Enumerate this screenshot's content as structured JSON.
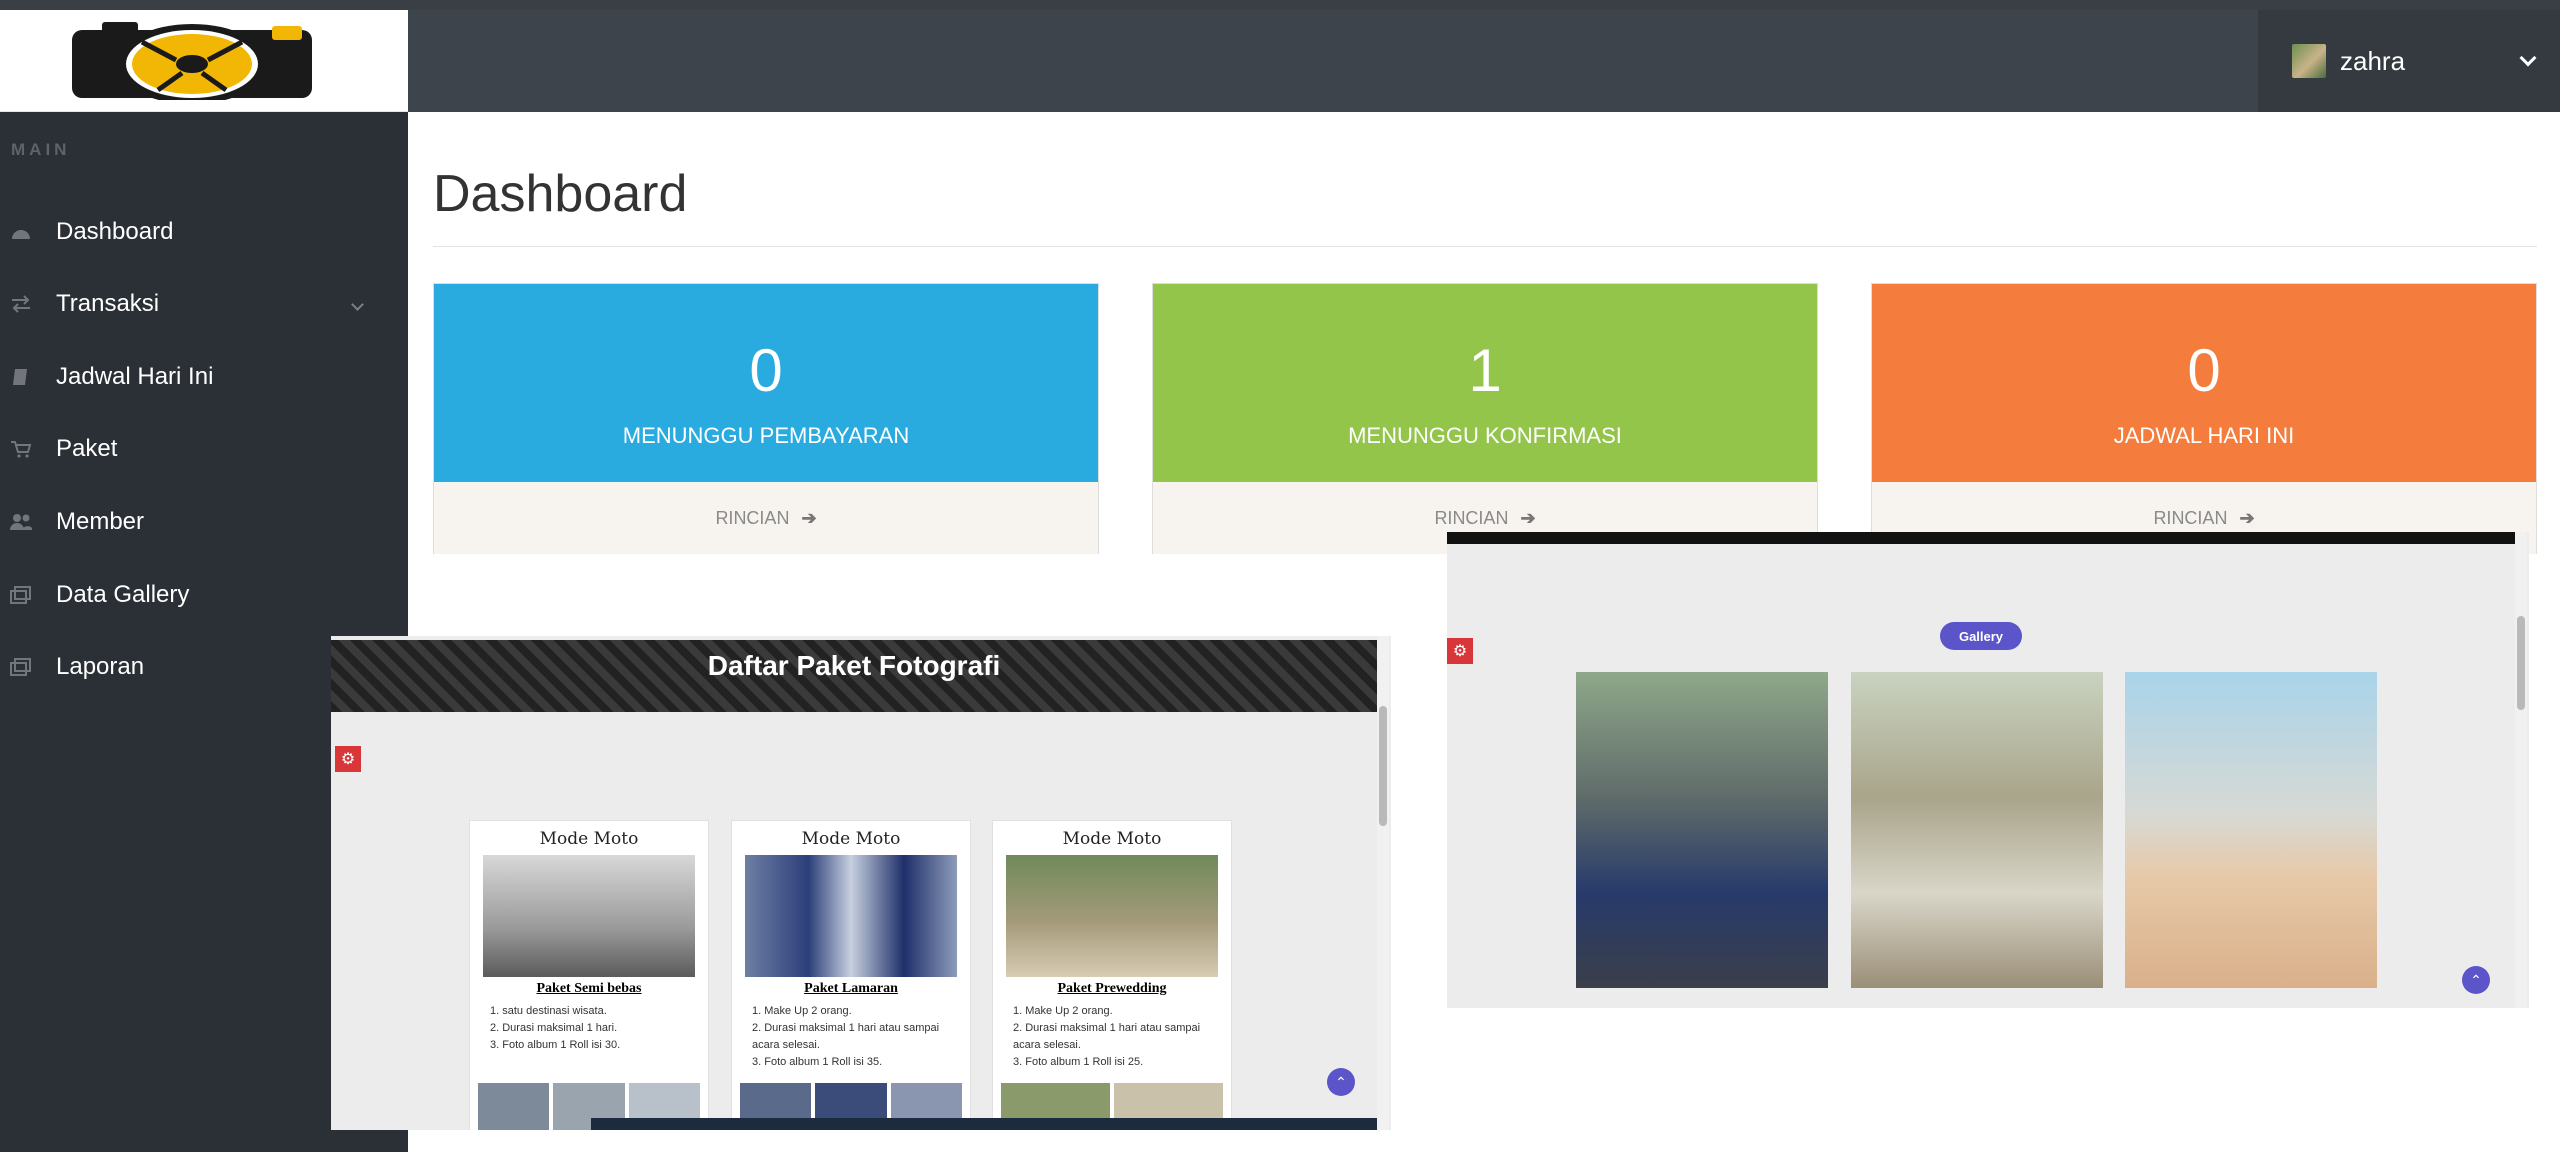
{
  "header": {
    "user": {
      "name": "zahra"
    }
  },
  "sidebar": {
    "heading": "MAIN",
    "items": [
      {
        "label": "Dashboard",
        "icon": "dashboard-icon"
      },
      {
        "label": "Transaksi",
        "icon": "exchange-icon",
        "has_submenu": true
      },
      {
        "label": "Jadwal Hari Ini",
        "icon": "book-icon"
      },
      {
        "label": "Paket",
        "icon": "cart-icon"
      },
      {
        "label": "Member",
        "icon": "users-icon"
      },
      {
        "label": "Data Gallery",
        "icon": "gallery-icon"
      },
      {
        "label": "Laporan",
        "icon": "report-icon"
      }
    ]
  },
  "main": {
    "title": "Dashboard",
    "cards": [
      {
        "value": "0",
        "label": "MENUNGGU PEMBAYARAN",
        "link": "RINCIAN",
        "color": "#29abe0"
      },
      {
        "value": "1",
        "label": "MENUNGGU KONFIRMASI",
        "link": "RINCIAN",
        "color": "#93c54b"
      },
      {
        "value": "0",
        "label": "JADWAL HARI INI",
        "link": "RINCIAN",
        "color": "#f47c3c"
      }
    ]
  },
  "packages_screenshot": {
    "title": "Daftar Paket Fotografi",
    "packages": [
      {
        "brand": "Mode Moto",
        "name": "Paket Semi bebas",
        "features": [
          "1. satu destinasi wisata.",
          "2. Durasi maksimal 1 hari.",
          "3. Foto album 1 Roll isi 30."
        ]
      },
      {
        "brand": "Mode Moto",
        "name": "Paket Lamaran",
        "features": [
          "1. Make Up 2 orang.",
          "2. Durasi maksimal 1 hari atau sampai acara selesai.",
          "3. Foto album 1 Roll isi 35."
        ]
      },
      {
        "brand": "Mode Moto",
        "name": "Paket Prewedding",
        "features": [
          "1. Make Up 2 orang.",
          "2. Durasi maksimal 1 hari atau sampai acara selesai.",
          "3. Foto album 1 Roll isi 25."
        ]
      }
    ]
  },
  "gallery_screenshot": {
    "badge": "Gallery"
  },
  "colors": {
    "sidebar": "#2b3036",
    "header": "#3e444c",
    "gear": "#d9363a",
    "accent": "#5b55c9"
  }
}
